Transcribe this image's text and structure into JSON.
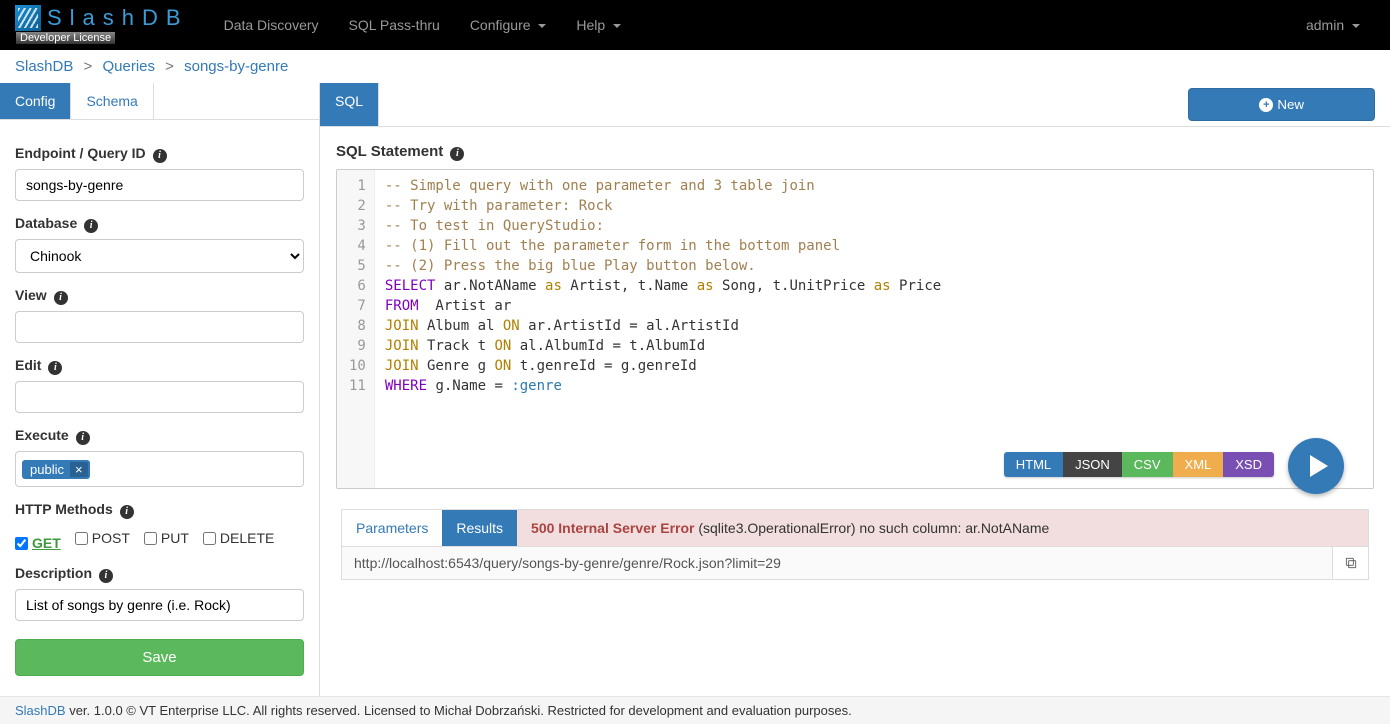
{
  "nav": {
    "brand": "SlashDB",
    "license": "Developer License",
    "items": [
      "Data Discovery",
      "SQL Pass-thru",
      "Configure",
      "Help"
    ],
    "dropdowns": [
      false,
      false,
      true,
      true
    ],
    "user": "admin"
  },
  "breadcrumb": [
    "SlashDB",
    "Queries",
    "songs-by-genre"
  ],
  "leftTabs": {
    "config": "Config",
    "schema": "Schema"
  },
  "rightTabs": {
    "sql": "SQL",
    "newBtn": "New"
  },
  "form": {
    "endpoint_label": "Endpoint / Query ID",
    "endpoint_value": "songs-by-genre",
    "database_label": "Database",
    "database_value": "Chinook",
    "view_label": "View",
    "view_value": "",
    "edit_label": "Edit",
    "edit_value": "",
    "execute_label": "Execute",
    "execute_tags": [
      "public"
    ],
    "http_label": "HTTP Methods",
    "methods": {
      "GET": true,
      "POST": false,
      "PUT": false,
      "DELETE": false
    },
    "description_label": "Description",
    "description_value": "List of songs by genre (i.e. Rock)",
    "save": "Save"
  },
  "sql": {
    "heading": "SQL Statement",
    "lines": [
      "-- Simple query with one parameter and 3 table join",
      "-- Try with parameter: Rock",
      "-- To test in QueryStudio:",
      "-- (1) Fill out the parameter form in the bottom panel",
      "-- (2) Press the big blue Play button below.",
      "SELECT ar.NotAName as Artist, t.Name as Song, t.UnitPrice as Price",
      "FROM  Artist ar",
      "JOIN Album al ON ar.ArtistId = al.ArtistId",
      "JOIN Track t ON al.AlbumId = t.AlbumId",
      "JOIN Genre g ON t.genreId = g.genreId",
      "WHERE g.Name = :genre"
    ],
    "formats": [
      "HTML",
      "JSON",
      "CSV",
      "XML",
      "XSD"
    ]
  },
  "results": {
    "tabs": {
      "parameters": "Parameters",
      "results": "Results"
    },
    "error_title": "500 Internal Server Error",
    "error_msg": "(sqlite3.OperationalError) no such column: ar.NotAName",
    "url": "http://localhost:6543/query/songs-by-genre/genre/Rock.json?limit=29"
  },
  "footer": {
    "brand": "SlashDB",
    "text": "ver. 1.0.0 © VT Enterprise LLC. All rights reserved. Licensed to Michał Dobrzański. Restricted for development and evaluation purposes."
  }
}
